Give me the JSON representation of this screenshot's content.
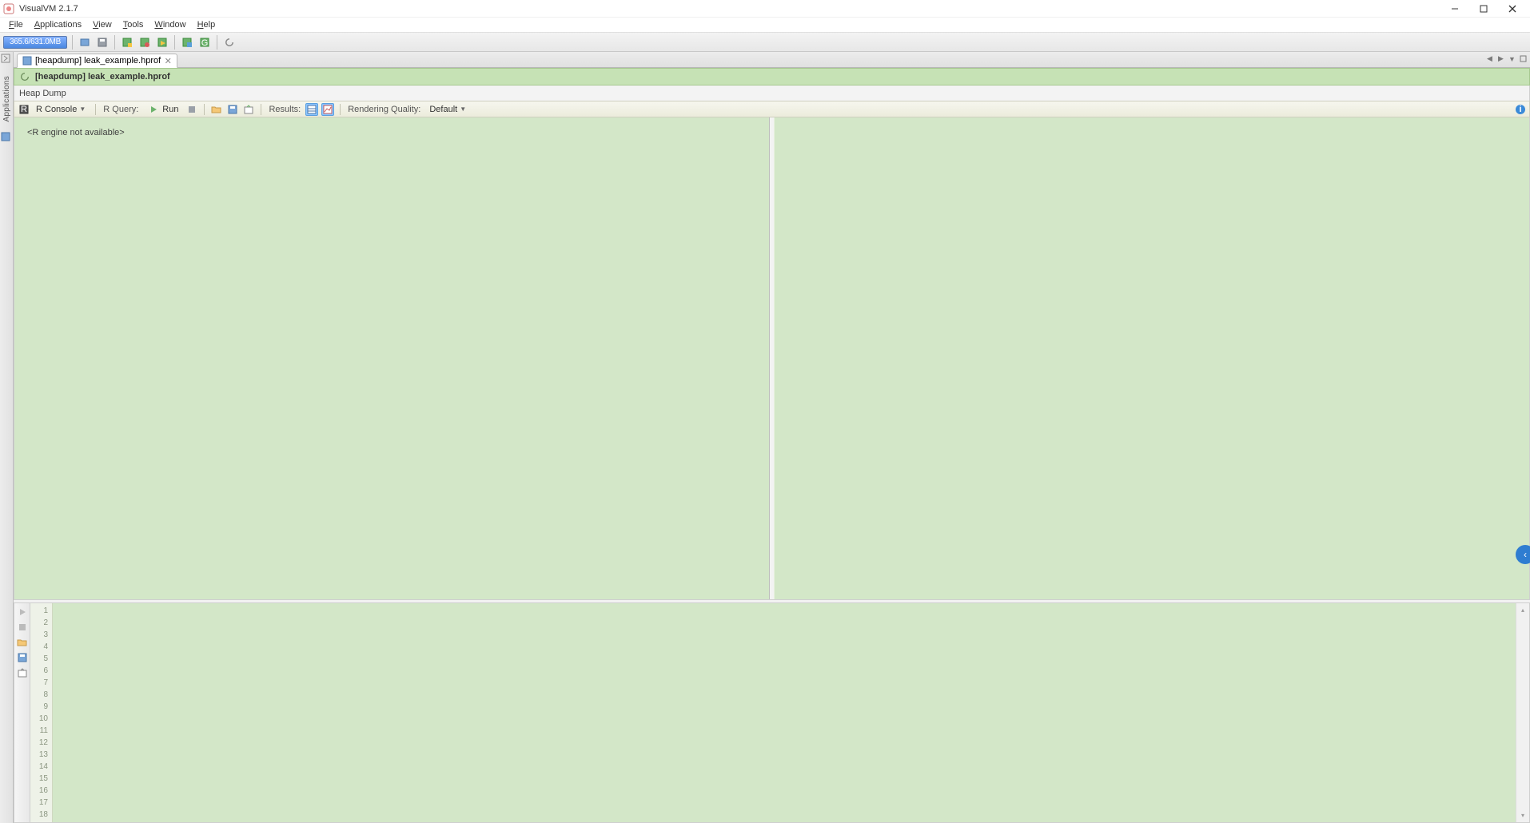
{
  "window": {
    "title": "VisualVM 2.1.7"
  },
  "menu": {
    "file": "File",
    "applications": "Applications",
    "view": "View",
    "tools": "Tools",
    "window": "Window",
    "help": "Help"
  },
  "toolbar": {
    "memory": "365.6/631.0MB"
  },
  "left_rail": {
    "label": "Applications"
  },
  "tab": {
    "label": "[heapdump] leak_example.hprof"
  },
  "doc": {
    "title": "[heapdump] leak_example.hprof",
    "subtitle": "Heap Dump"
  },
  "doc_toolbar": {
    "r_console": "R Console",
    "r_query": "R Query:",
    "run": "Run",
    "results": "Results:",
    "render_quality": "Rendering Quality:",
    "render_value": "Default"
  },
  "pane": {
    "left_message": "<R engine not available>"
  },
  "editor": {
    "line_count": 18
  }
}
